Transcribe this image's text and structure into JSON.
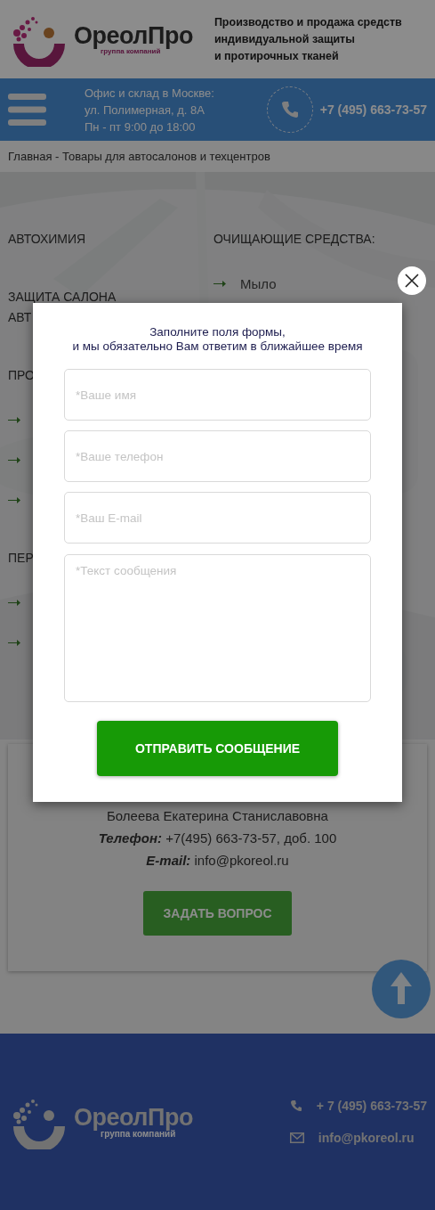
{
  "header": {
    "logo": {
      "name": "ОреолПро",
      "tagline": "группа компаний"
    },
    "slogan_lines": [
      "Производство и продажа средств",
      "индивидуальной защиты",
      "и протирочных тканей"
    ]
  },
  "topbar": {
    "address_lines": [
      "Офис и склад в Москве:",
      "ул. Полимерная, д. 8А",
      "Пн - пт 9:00 до 18:00"
    ],
    "phone": "+7 (495) 663-73-57"
  },
  "breadcrumb": "Главная - Товары для автосалонов и техцентров",
  "categories": {
    "left": [
      {
        "kind": "heading",
        "lines": [
          "АВТОХИМИЯ"
        ]
      },
      {
        "kind": "heading",
        "lines": [
          "ЗАЩИТА САЛОНА",
          "АВТ"
        ]
      },
      {
        "kind": "heading",
        "lines": [
          "ПРО"
        ]
      },
      {
        "kind": "link"
      },
      {
        "kind": "link"
      },
      {
        "kind": "link"
      },
      {
        "kind": "heading",
        "lines": [
          "ПЕР"
        ]
      },
      {
        "kind": "link"
      },
      {
        "kind": "link"
      }
    ],
    "right": [
      {
        "kind": "heading",
        "lines": [
          "ОЧИЩАЮЩИЕ СРЕДСТВА:"
        ]
      },
      {
        "kind": "link",
        "text": "Мыло"
      }
    ]
  },
  "contact_card": {
    "name": "Болеева Екатерина Станиславовна",
    "phone": "**Телефон:** +7(495) 663-73-57, доб. 100",
    "email": "**E-mail:** info@pkoreol.ru",
    "button": "ЗАДАТЬ ВОПРОС"
  },
  "footer": {
    "logo": {
      "name": "ОреолПро",
      "tagline": "группа компаний"
    },
    "phone": "+ 7 (495) 663-73-57",
    "email": "info@pkoreol.ru"
  },
  "modal": {
    "title_lines": [
      "Заполните поля  формы,",
      "и мы обязательно Вам ответим в ближайшее время"
    ],
    "fields": [
      {
        "kind": "input",
        "placeholder": "*Ваше имя"
      },
      {
        "kind": "input",
        "placeholder": "*Ваше телефон"
      },
      {
        "kind": "input",
        "placeholder": "*Ваш E-mail"
      },
      {
        "kind": "textarea",
        "placeholder": "*Текст сообщения"
      }
    ],
    "submit_button": "ОТПРАВИТЬ СООБЩЕНИЕ"
  }
}
